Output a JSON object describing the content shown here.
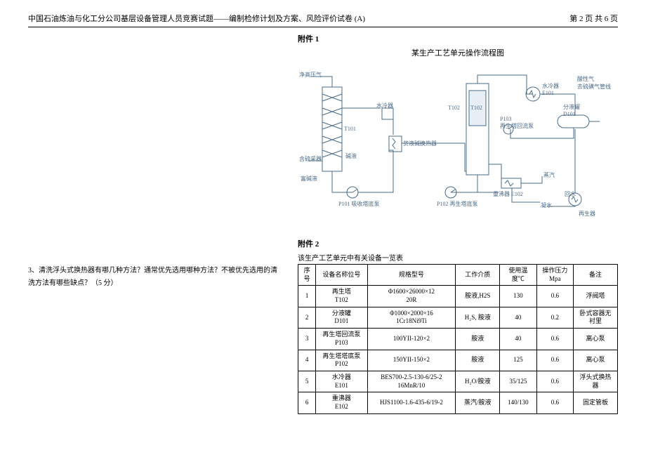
{
  "header": {
    "title": "中国石油炼油与化工分公司基层设备管理人员竞赛试题——编制检修计划及方案、风险评价试卷 (A)",
    "pager": "第 2 页 共 6 页"
  },
  "question": {
    "text": "3、清洗浮头式换热器有哪几种方法？通常优先选用哪种方法？不被优先选用的清洗方法有哪些缺点？（5 分）"
  },
  "attachment1": {
    "label": "附件 1",
    "title": "某生产工艺单元操作流程图",
    "diagram": {
      "t101": "T101",
      "t102a": "T102",
      "t102b": "T102",
      "p101": "P101 吸收塔底泵",
      "p102": "P102 再生塔底泵",
      "p103": "P103\n再生塔回流泵",
      "e101": "水冷器\nE101",
      "e102": "重沸器 E102",
      "d101": "分液罐\nD101",
      "water_cooler": "水冷器",
      "lean_rich": "贫液碱换热器",
      "lean_liquid": "碱液",
      "rich_liquid": "富碱液",
      "return_liq": "回水",
      "steam": "蒸汽",
      "cond": "凝水",
      "acid_gas": "酸性气\n去硫磺气管线",
      "to_abs": "含硫采器",
      "clean_gas": "净高压气"
    }
  },
  "attachment2": {
    "label": "附件 2",
    "caption": "该生产工艺单元中有关设备一览表",
    "headers": {
      "seq": "序号",
      "name": "设备名称位号",
      "spec": "规格型号",
      "medium": "工作介质",
      "temp": "使用温度℃",
      "pressure": "操作压力Mpa",
      "note": "备注"
    },
    "rows": [
      {
        "seq": "1",
        "name": "再生塔\nT102",
        "spec": "Φ1600×26000×12\n20R",
        "medium": "胺液,H2S",
        "temp": "130",
        "pressure": "0.6",
        "note": "浮阀塔"
      },
      {
        "seq": "2",
        "name": "分液罐\nD101",
        "spec": "Φ1000×2000×16\n1Cr18Ni9Ti",
        "medium": "H₂S, 胺液",
        "temp": "40",
        "pressure": "0.2",
        "note": "卧式容器无衬里"
      },
      {
        "seq": "3",
        "name": "再生塔回流泵\nP103",
        "spec": "100YII-120×2",
        "medium": "胺液",
        "temp": "40",
        "pressure": "0.6",
        "note": "离心泵"
      },
      {
        "seq": "4",
        "name": "再生塔塔底泵\nP102",
        "spec": "150YII-150×2",
        "medium": "胺液",
        "temp": "125",
        "pressure": "0.6",
        "note": "离心泵"
      },
      {
        "seq": "5",
        "name": "水冷器\nE101",
        "spec": "BES700-2.5-130-6/25-2\n16MnR/10",
        "medium": "H₂O/胺液",
        "temp": "35/125",
        "pressure": "0.6",
        "note": "浮头式换热器"
      },
      {
        "seq": "6",
        "name": "重沸器\nE102",
        "spec": "HJS1100-1.6-435-6/19-2",
        "medium": "蒸汽/胺液",
        "temp": "140/130",
        "pressure": "0.6",
        "note": "固定管板"
      }
    ]
  }
}
